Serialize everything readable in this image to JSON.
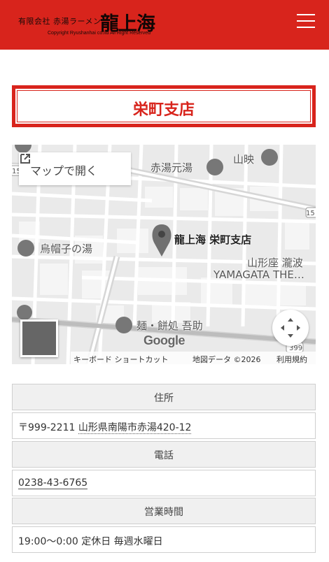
{
  "header": {
    "company": "有限会社 赤湯ラーメン",
    "brand": "龍上海",
    "copyright": "Copyright Ryushanhai co.ltd All Right Reserved",
    "menu_icon": "hamburger-menu-icon",
    "bg_color": "#d8241c"
  },
  "store": {
    "title": "栄町支店"
  },
  "map": {
    "open_label": "マップで開く",
    "open_icon": "external-link-icon",
    "pin_label": "龍上海 栄町支店",
    "places": {
      "akayu_motoyu": "赤湯元湯",
      "sanei": "山映",
      "eboshiko": "烏帽子の湯",
      "yamagataza": "山形座 瀧波",
      "yamagata_the": "YAMAGATA THE…",
      "men_mochi": "麺・餅処 吾助"
    },
    "route_numbers": [
      "15",
      "15",
      "399"
    ],
    "google": "Google",
    "attribution": {
      "keyboard": "キーボード ショートカット",
      "mapdata": "地図データ ©2026",
      "terms": "利用規約"
    }
  },
  "info": {
    "address_head": "住所",
    "address_value": "〒999-2211 山形県南陽市赤湯420-12",
    "address_postal": "〒999-2211 ",
    "address_link": "山形県南陽市赤湯420-12",
    "phone_head": "電話",
    "phone_value": "0238-43-6765",
    "hours_head": "営業時間",
    "hours_value": "19:00〜0:00 定休日 毎週水曜日"
  }
}
